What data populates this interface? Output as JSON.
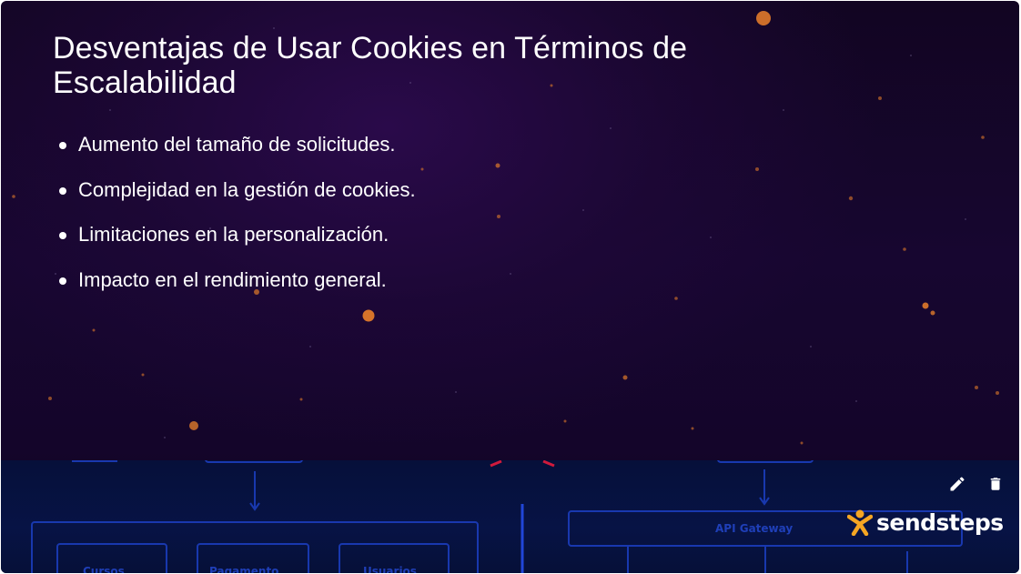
{
  "slide": {
    "title": "Desventajas de Usar Cookies en Términos de Escalabilidad",
    "bullets": [
      "Aumento del tamaño de solicitudes.",
      "Complejidad en la gestión de cookies.",
      "Limitaciones en la personalización.",
      "Impacto en el rendimiento general."
    ]
  },
  "background_diagram": {
    "gateway_label": "API Gateway",
    "boxes": [
      "Cursos",
      "Pagamento",
      "Usuarios"
    ]
  },
  "toolbar": {
    "edit_icon": "pencil-icon",
    "delete_icon": "trash-icon"
  },
  "brand": {
    "name": "sendsteps",
    "accent_color": "#f5a623"
  },
  "colors": {
    "background_top": "#170630",
    "background_bottom": "#071345",
    "text": "#ffffff",
    "star": "#e07a2a"
  }
}
